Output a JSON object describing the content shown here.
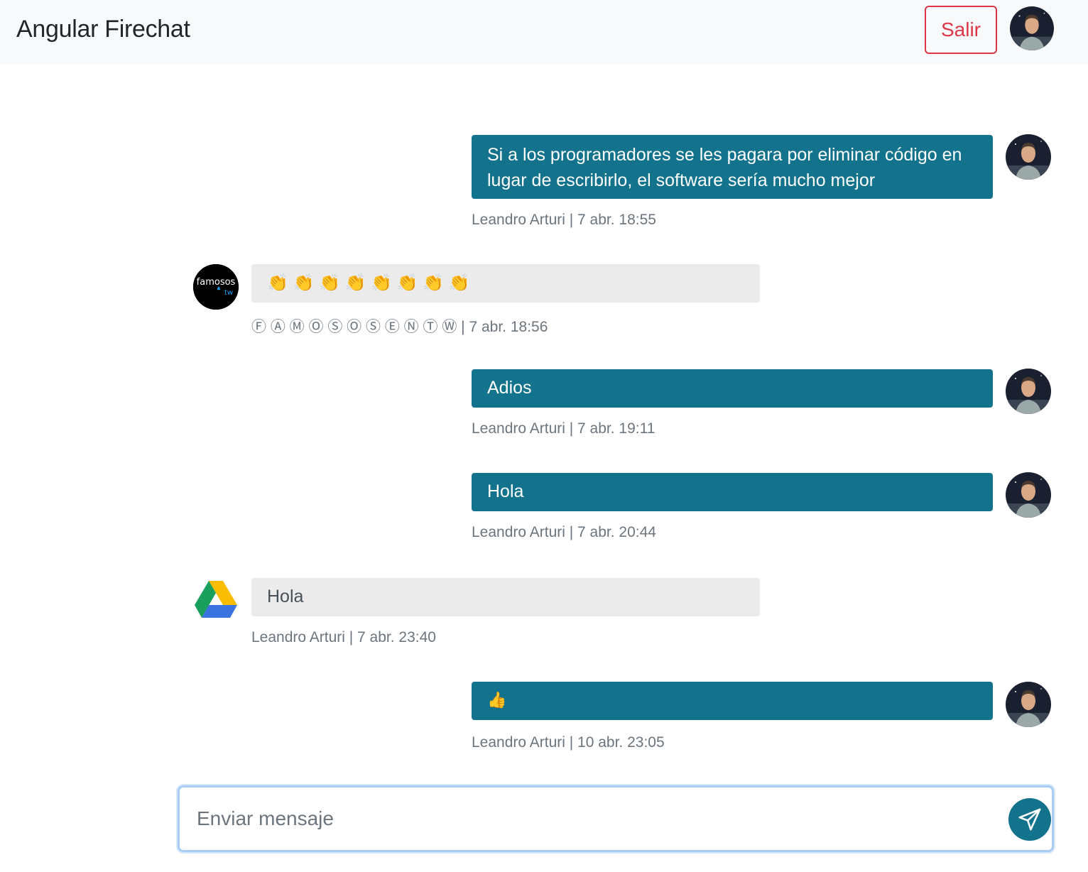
{
  "navbar": {
    "brand": "Angular Firechat",
    "logout_label": "Salir",
    "avatar_icon": "user-avatar-photo"
  },
  "messages": [
    {
      "side": "mine",
      "text": "Si a los programadores se les pagara por eliminar código en lugar de escribirlo, el software sería mucho mejor",
      "meta": "Leandro Arturi | 7 abr. 18:55",
      "avatar": "user-avatar-photo"
    },
    {
      "side": "theirs",
      "text": "👏 👏 👏 👏 👏 👏 👏 👏",
      "meta": "Ⓕ Ⓐ Ⓜ Ⓞ Ⓢ Ⓞ Ⓢ Ⓔ Ⓝ Ⓣ Ⓦ | 7 abr. 18:56",
      "avatar": "famosos-tw-logo",
      "avatar_text": "famosos",
      "avatar_subtext": "tw"
    },
    {
      "side": "mine",
      "text": "Adios",
      "meta": "Leandro Arturi | 7 abr. 19:11",
      "avatar": "user-avatar-photo"
    },
    {
      "side": "mine",
      "text": "Hola",
      "meta": "Leandro Arturi | 7 abr. 20:44",
      "avatar": "user-avatar-photo"
    },
    {
      "side": "theirs",
      "text": "Hola",
      "meta": "Leandro Arturi | 7 abr. 23:40",
      "avatar": "google-drive-logo"
    },
    {
      "side": "mine",
      "text": "👍",
      "meta": "Leandro Arturi | 10 abr. 23:05",
      "avatar": "user-avatar-photo"
    }
  ],
  "composer": {
    "placeholder": "Enviar mensaje",
    "value": "",
    "send_icon": "paper-plane-icon"
  },
  "colors": {
    "own_bubble": "#13738c",
    "other_bubble": "#ebebeb",
    "danger": "#dc3545",
    "navbar_bg": "#f8f9fa"
  }
}
